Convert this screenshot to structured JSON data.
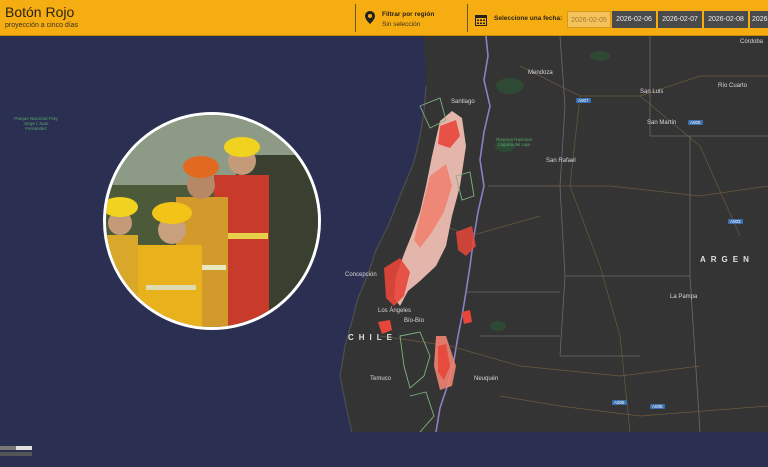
{
  "app": {
    "title": "Botón Rojo",
    "subtitle": "proyección a cinco días"
  },
  "region_filter": {
    "label": "Filtrar por región",
    "value": "Sin selección"
  },
  "date_selector": {
    "label": "Seleccione una fecha:",
    "dates": [
      "2026-02-05",
      "2026-02-06",
      "2026-02-07",
      "2026-02-08",
      "2026"
    ],
    "selected": "2026-02-05"
  },
  "map": {
    "country_labels": {
      "chile": "CHILE",
      "argentina": "ARGEN"
    },
    "cities": {
      "cordoba": "Córdoba",
      "mendoza": "Mendoza",
      "san_luis": "San Luis",
      "rio_cuarto": "Río Cuarto",
      "santiago": "Santiago",
      "san_rafael": "San Rafael",
      "concepcion": "Concepción",
      "los_angeles": "Los Ángeles",
      "biobio": "Bío-Bío",
      "temuco": "Temuco",
      "neuquen": "Neuquén",
      "la_pampa": "La Pampa",
      "san_martin": "San Martín"
    },
    "parks": {
      "fray_jorge": "Parque Nacional Fray Jorge / Juan Fernández",
      "laguna": "Reserva Nacional Laguna del Laja"
    },
    "routes": [
      "A007",
      "A005",
      "A003",
      "A005",
      "A006"
    ]
  },
  "colors": {
    "header_bg": "#f6ad12",
    "sea": "#2b2f52",
    "land": "#343434",
    "risk_high": "#e8463a",
    "risk_low": "#f7c4b8"
  }
}
